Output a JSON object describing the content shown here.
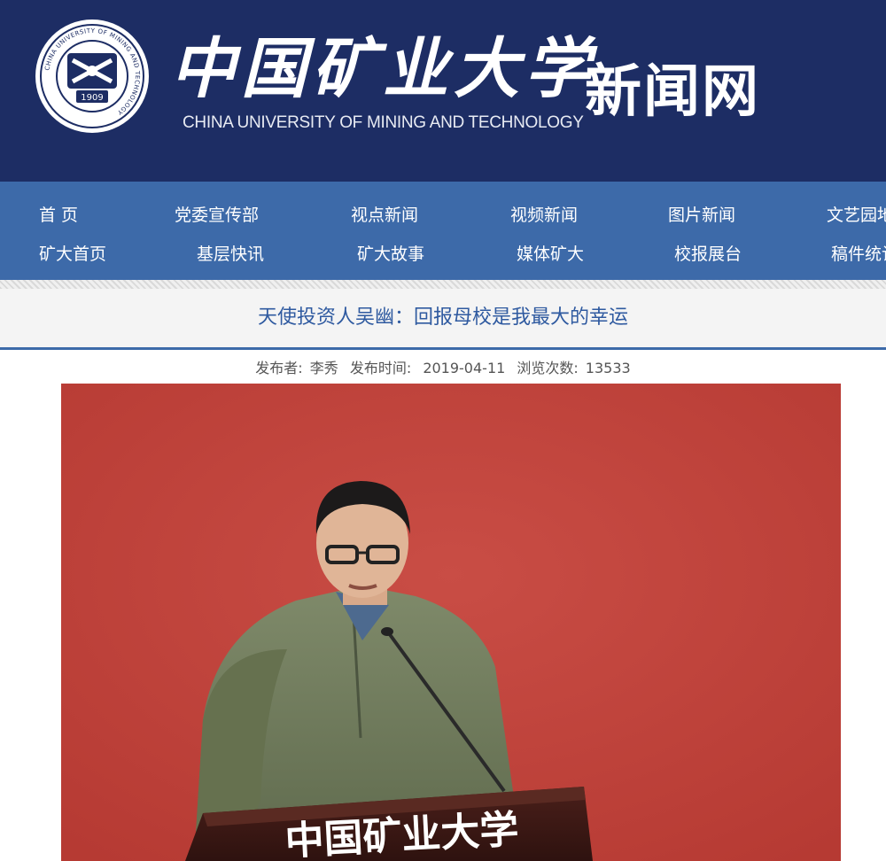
{
  "header": {
    "university_cn": "中国矿业大学",
    "university_en": "CHINA UNIVERSITY OF MINING AND TECHNOLOGY",
    "site_name": "新闻网",
    "seal_year": "1909",
    "seal_text": "CHINA UNIVERSITY OF MINING AND TECHNOLOGY",
    "colors": {
      "header_bg": "#1d2d64",
      "nav_bg": "#3d6aa9",
      "title": "#2f5aa0"
    }
  },
  "nav": {
    "row1": [
      "首 页",
      "党委宣传部",
      "视点新闻",
      "视频新闻",
      "图片新闻",
      "文艺园地"
    ],
    "row2": [
      "矿大首页",
      "基层快讯",
      "矿大故事",
      "媒体矿大",
      "校报展台",
      "稿件统计"
    ]
  },
  "article": {
    "title": "天使投资人吴幽：回报母校是我最大的幸运",
    "publisher_label": "发布者:",
    "publisher": "李秀",
    "time_label": "发布时间:",
    "date": "2019-04-11",
    "views_label": "浏览次数:",
    "views": "13533"
  },
  "photo": {
    "podium_text": "中国矿业大学",
    "icon": "photo-speaker-at-podium"
  }
}
